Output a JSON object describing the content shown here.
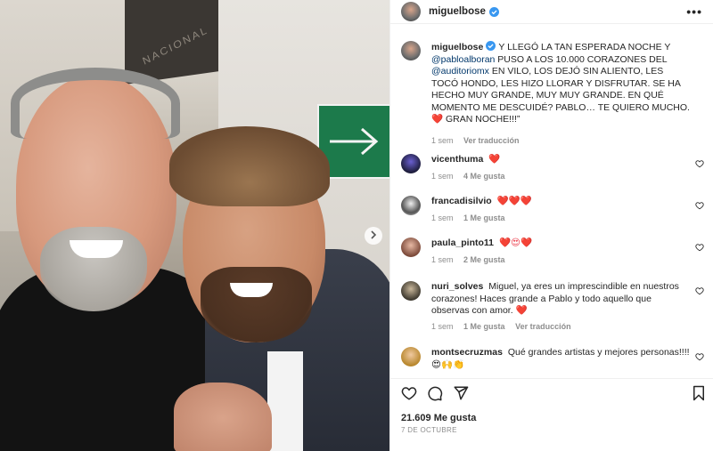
{
  "post": {
    "username": "miguelbose",
    "more_icon": "more-horizontal-icon",
    "photo_sign_text": "NACIONAL",
    "caption": {
      "username": "miguelbose",
      "part1": "Y LLEGÓ LA TAN ESPERADA NOCHE Y ",
      "mention1": "@pabloalboran",
      "part2": " PUSO A LOS 10.000 CORAZONES DEL ",
      "mention2": "@auditoriomx",
      "part3": " EN VILO, LOS DEJÓ SIN ALIENTO, LES TOCÓ HONDO, LES HIZO LLORAR Y DISFRUTAR. SE HA HECHO MUY GRANDE, MUY MUY GRANDE. EN QUÉ MOMENTO ME DESCUIDÉ? PABLO… TE QUIERO MUCHO. ",
      "heart": "❤️",
      "part4": " GRAN NOCHE!!!”",
      "time": "1 sem",
      "translate": "Ver traducción"
    },
    "comments": [
      {
        "username": "vicenthuma",
        "text": "❤️",
        "time": "1 sem",
        "likes": "4 Me gusta",
        "reply": ""
      },
      {
        "username": "francadisilvio",
        "text": "❤️❤️❤️",
        "time": "1 sem",
        "likes": "1 Me gusta",
        "reply": ""
      },
      {
        "username": "paula_pinto11",
        "text": "❤️😍❤️",
        "time": "1 sem",
        "likes": "2 Me gusta",
        "reply": ""
      },
      {
        "username": "nuri_solves",
        "text": "Miguel, ya eres un imprescindible en nuestros corazones! Haces grande a Pablo y todo aquello que observas con amor. ❤️",
        "time": "1 sem",
        "likes": "1 Me gusta",
        "reply": "Ver traducción"
      },
      {
        "username": "montsecruzmas",
        "text": "Qué grandes artistas y mejores personas!!!! 😍🙌👏",
        "time": "",
        "likes": "",
        "reply": ""
      }
    ],
    "actions": {
      "like_icon": "heart-outline-icon",
      "comment_icon": "comment-icon",
      "share_icon": "send-icon",
      "save_icon": "bookmark-icon"
    },
    "likes_count": "21.609 Me gusta",
    "date": "7 DE OCTUBRE"
  }
}
